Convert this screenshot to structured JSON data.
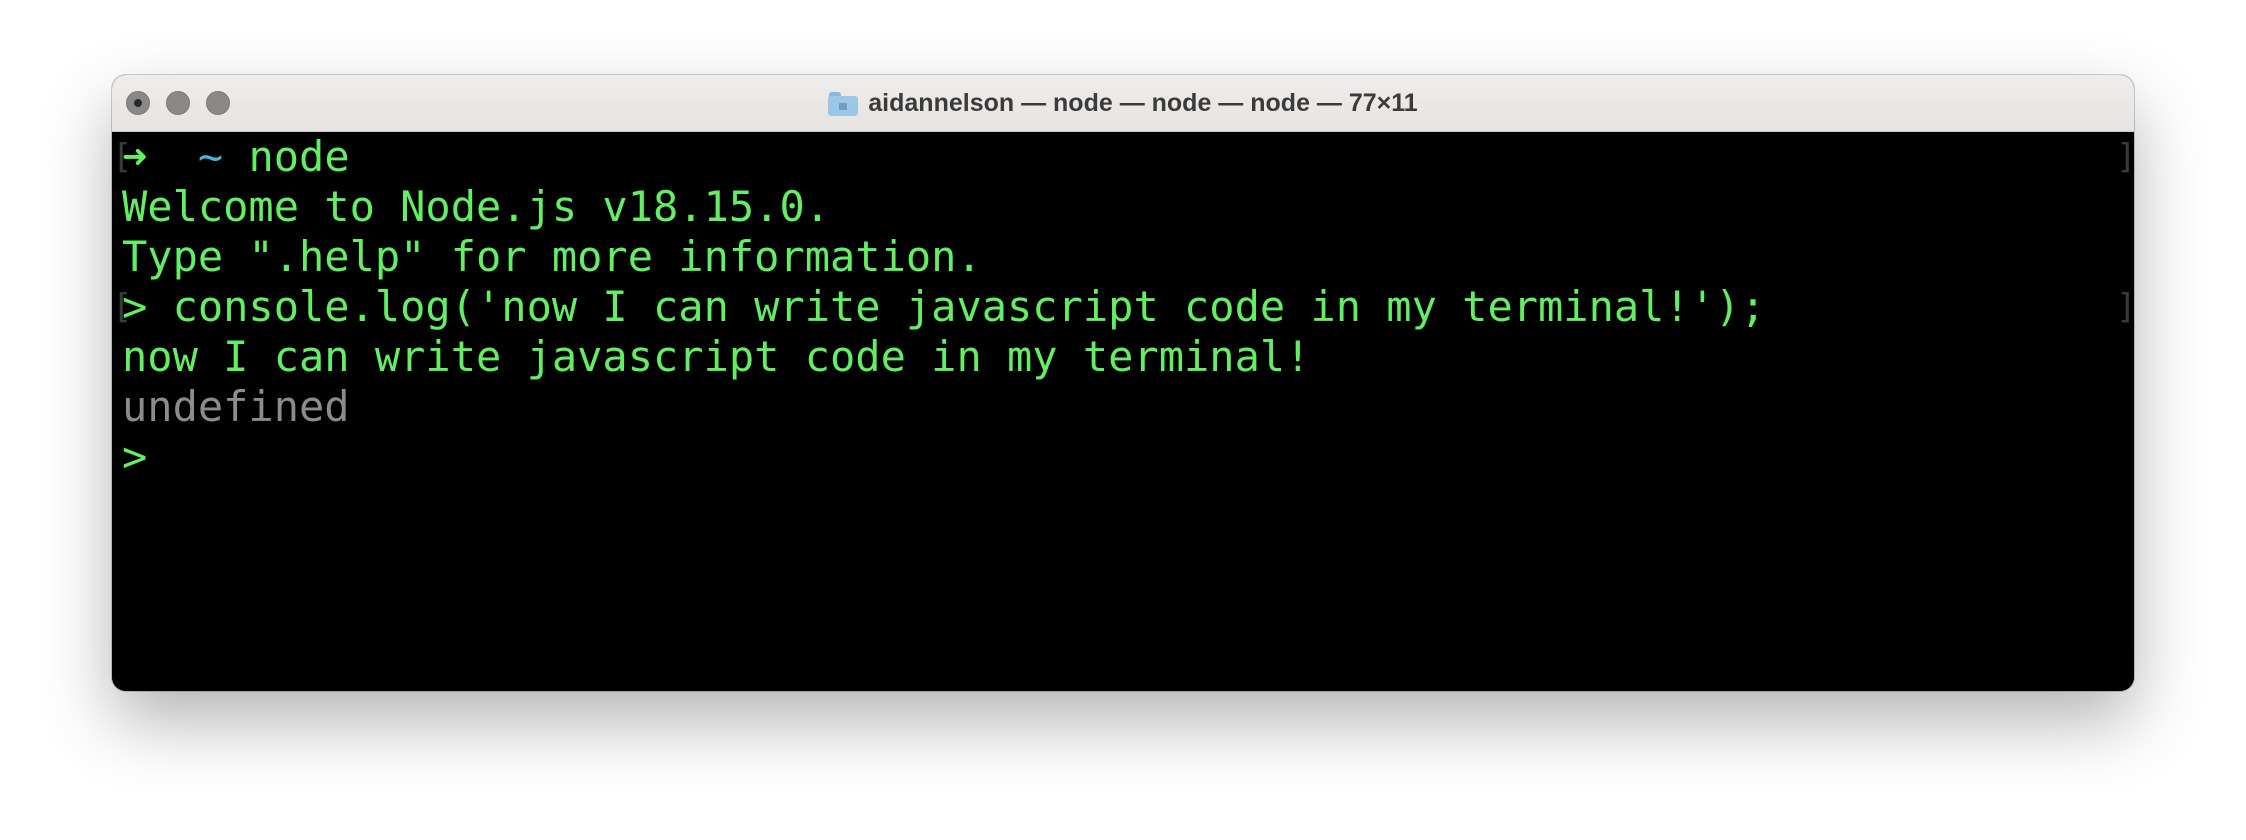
{
  "window": {
    "title": "aidannelson — node — node — node — 77×11"
  },
  "terminal": {
    "prompt": {
      "bracket_open": "[",
      "arrow": "➜",
      "tilde": "~",
      "command": "node"
    },
    "welcome": "Welcome to Node.js v18.15.0.",
    "help": "Type \".help\" for more information.",
    "input": {
      "bracket_open": "[",
      "text": "> console.log('now I can write javascript code in my terminal!');"
    },
    "output": "now I can write javascript code in my terminal!",
    "return_value": "undefined",
    "current_prompt": ">",
    "bracket_close": "]"
  },
  "colors": {
    "text_green": "#63ee63",
    "tilde_blue": "#4fb2d6",
    "undefined_gray": "#8c8c8c",
    "background": "#000000"
  }
}
